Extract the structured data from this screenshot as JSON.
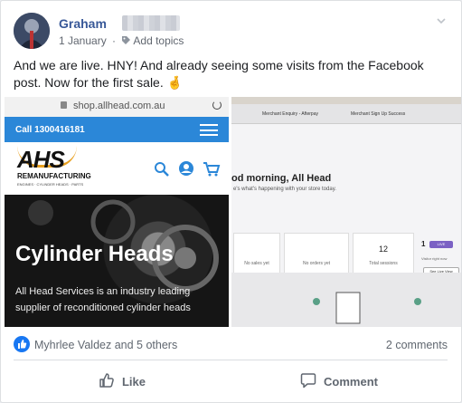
{
  "post": {
    "author": "Graham",
    "date": "1 January",
    "separator": "·",
    "add_topics": "Add topics",
    "text": "And we are live. HNY! And already seeing some visits from the Facebook post. Now for the first sale. 🤞"
  },
  "photo_left": {
    "address": "shop.allhead.com.au",
    "call": "Call 1300416181",
    "logo": "AHS",
    "logo_sub1": "REMANUFACTURING",
    "logo_sub2": "ENGINES · CYLINDER HEADS · PARTS",
    "hero_title": "Cylinder Heads",
    "hero_body": "All Head Services is an industry leading supplier of reconditioned cylinder heads"
  },
  "photo_right": {
    "tab1": "Merchant Enquiry - Afterpay",
    "tab2": "Merchant Sign Up Success",
    "greeting": "od morning, All Head",
    "greeting_sub": "e's what's happening with your store today.",
    "stat1_label": "No sales yet",
    "stat2_label": "No orders yet",
    "stat3_value": "12",
    "stat3_label": "Total sessions",
    "live_value": "1",
    "live_badge": "LIVE",
    "live_sub": "Visitor right now",
    "live_btn": "See Live View"
  },
  "reactions": {
    "likers": "Myhrlee Valdez and 5 others",
    "comments": "2 comments"
  },
  "actions": {
    "like": "Like",
    "comment": "Comment"
  },
  "colors": {
    "facebook_blue": "#1877f2",
    "name_blue": "#385898",
    "shop_blue": "#2b87d8",
    "live_purple": "#7b61c4"
  }
}
